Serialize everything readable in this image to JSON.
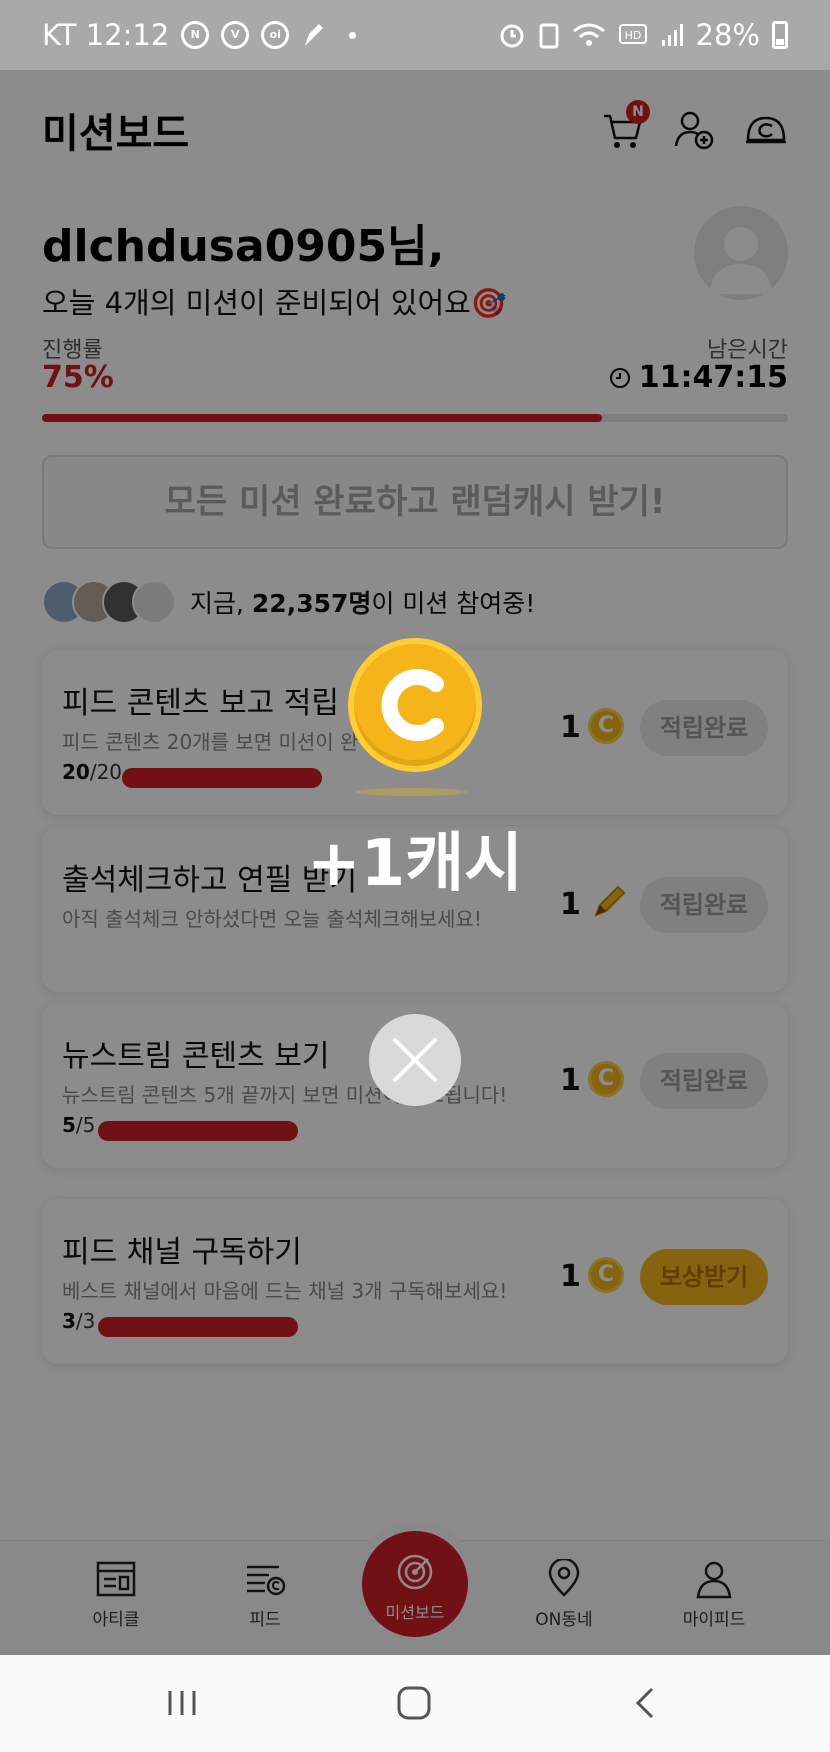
{
  "status_bar": {
    "carrier_time": "KT 12:12",
    "battery": "28%",
    "left_icons": [
      "lock-ring-icon",
      "v4-icon",
      "oilock-icon",
      "pen-icon"
    ],
    "right_icons": [
      "alarm-icon",
      "battery-saver-icon",
      "wifi-icon",
      "hd-voice-icon",
      "signal-icon"
    ]
  },
  "header": {
    "title": "미션보드",
    "cart_badge": "N"
  },
  "greeting": {
    "user": "dlchdusa0905님,",
    "subtitle": "오늘 4개의 미션이 준비되어 있어요🎯"
  },
  "progress": {
    "label": "진행률",
    "value": "75%",
    "fraction": 0.75,
    "remaining_label": "남은시간",
    "remaining_time": "11:47:15"
  },
  "all_missions_button": "모든 미션 완료하고 랜덤캐시 받기!",
  "participants": {
    "prefix": "지금, ",
    "count": "22,357명",
    "suffix": "이 미션 참여중!"
  },
  "missions": [
    {
      "title": "피드 콘텐츠 보고 적립",
      "desc": "피드 콘텐츠 20개를 보면 미션이 완",
      "done": "20",
      "total": "/20",
      "fraction": 1.0,
      "reward": "1",
      "reward_icon": "coin-icon",
      "status": "적립완료"
    },
    {
      "title": "출석체크하고 연필 받기",
      "desc": "아직 출석체크 안하셨다면 오늘 출석체크해보세요!",
      "reward": "1",
      "reward_icon": "pencil-icon",
      "status": "적립완료"
    },
    {
      "title": "뉴스트림 콘텐츠 보기",
      "desc": "뉴스트림 콘텐츠 5개 끝까지 보면 미션이 완료됩니다!",
      "done": "5",
      "total": "/5",
      "fraction": 1.0,
      "reward": "1",
      "reward_icon": "coin-icon",
      "status": "적립완료"
    },
    {
      "title": "피드 채널 구독하기",
      "desc": "베스트 채널에서 마음에 드는 채널 3개 구독해보세요!",
      "done": "3",
      "total": "/3",
      "fraction": 1.0,
      "reward": "1",
      "reward_icon": "coin-icon",
      "status": "보상받기"
    }
  ],
  "bottom_nav": {
    "items": [
      "아티클",
      "피드",
      "미션보드",
      "ON동네",
      "마이피드"
    ]
  },
  "popup": {
    "cash_text": "+1캐시"
  },
  "colors": {
    "accent": "#d01f27",
    "coin": "#f4b41a",
    "overlay": "rgba(0,0,0,0.45)"
  }
}
